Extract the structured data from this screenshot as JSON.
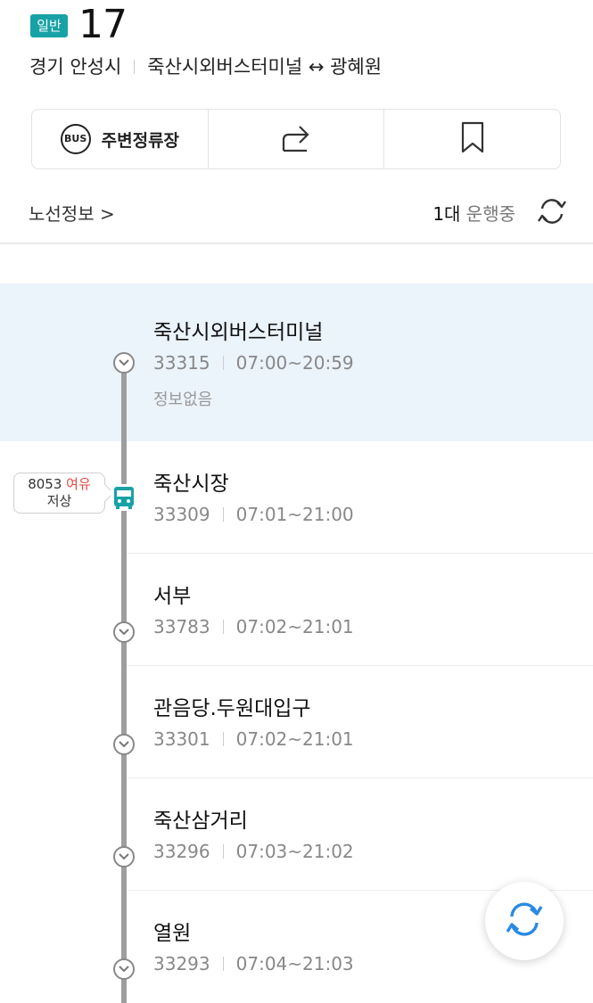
{
  "header": {
    "badge": "일반",
    "route_number": "17",
    "region": "경기 안성시",
    "route_span": "죽산시외버스터미널 ↔ 광혜원"
  },
  "actions": {
    "nearby_stops_icon_text": "BUS",
    "nearby_stops_label": "주변정류장",
    "share_icon": "share-icon",
    "bookmark_icon": "bookmark-icon"
  },
  "info_row": {
    "route_info_link": "노선정보 >",
    "running_count": "1대",
    "running_label": " 운행중",
    "refresh_icon": "refresh-icon"
  },
  "stops": [
    {
      "name": "죽산시외버스터미널",
      "id": "33315",
      "hours": "07:00~20:59",
      "note": "정보없음"
    },
    {
      "name": "죽산시장",
      "id": "33309",
      "hours": "07:01~21:00"
    },
    {
      "name": "서부",
      "id": "33783",
      "hours": "07:02~21:01"
    },
    {
      "name": "관음당.두원대입구",
      "id": "33301",
      "hours": "07:02~21:01"
    },
    {
      "name": "죽산삼거리",
      "id": "33296",
      "hours": "07:03~21:02"
    },
    {
      "name": "열원",
      "id": "33293",
      "hours": "07:04~21:03"
    }
  ],
  "bus": {
    "plate": "8053",
    "seat_status": "여유",
    "floor_type": "저상"
  },
  "colors": {
    "badge": "#17a2a6",
    "bus_icon": "#17a2a6",
    "first_stop_highlight": "#ebf3fb",
    "seat_status": "#e24b43",
    "fab_icon": "#2a8ae0"
  }
}
